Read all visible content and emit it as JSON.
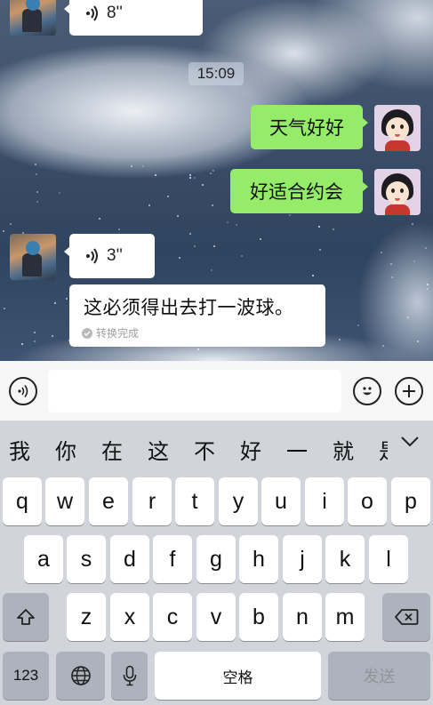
{
  "chat": {
    "top_voice": {
      "duration": "8''"
    },
    "timestamp": "15:09",
    "sent_1": "天气好好",
    "sent_2": "好适合约会",
    "voice_2": {
      "duration": "3''"
    },
    "transcription": {
      "text": "这必须得出去打一波球。",
      "status": "转换完成"
    }
  },
  "input_bar": {
    "voice_icon": "voice-mode-icon",
    "emoji_icon": "emoji-icon",
    "plus_icon": "plus-icon"
  },
  "candidates": [
    "我",
    "你",
    "在",
    "这",
    "不",
    "好",
    "一",
    "就",
    "是"
  ],
  "keyboard": {
    "row1": [
      "q",
      "w",
      "e",
      "r",
      "t",
      "y",
      "u",
      "i",
      "o",
      "p"
    ],
    "row2": [
      "a",
      "s",
      "d",
      "f",
      "g",
      "h",
      "j",
      "k",
      "l"
    ],
    "row3": [
      "z",
      "x",
      "c",
      "v",
      "b",
      "n",
      "m"
    ],
    "numbers_label": "123",
    "space_label": "空格",
    "send_label": "发送"
  },
  "colors": {
    "sent_bubble": "#95ec69",
    "received_bubble": "#ffffff",
    "keyboard_bg": "#d1d5db"
  }
}
